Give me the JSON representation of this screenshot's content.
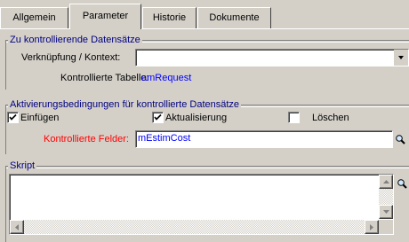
{
  "tabs": [
    "Allgemein",
    "Parameter",
    "Historie",
    "Dokumente"
  ],
  "section1": {
    "title": "Zu kontrollierende Datensätze",
    "link_label": "Verknüpfung / Kontext:",
    "link_value": "",
    "table_label": "Kontrollierte Tabelle:",
    "table_value": "amRequest"
  },
  "section2": {
    "title": "Aktivierungsbedingungen für kontrollierte Datensätze",
    "insert_label": "Einfügen",
    "insert_checked": true,
    "update_label": "Aktualisierung",
    "update_checked": true,
    "delete_label": "Löschen",
    "delete_checked": false,
    "fields_label": "Kontrollierte Felder:",
    "fields_value": "mEstimCost"
  },
  "section3": {
    "title": "Skript",
    "script_value": ""
  },
  "icons": {
    "zoom": "magnifier-icon",
    "dropdown": "chevron-down-icon"
  },
  "colors": {
    "background": "#d4d0c8",
    "section_title": "#000080",
    "value_blue": "#0000ff",
    "required_red": "#ff0000"
  }
}
